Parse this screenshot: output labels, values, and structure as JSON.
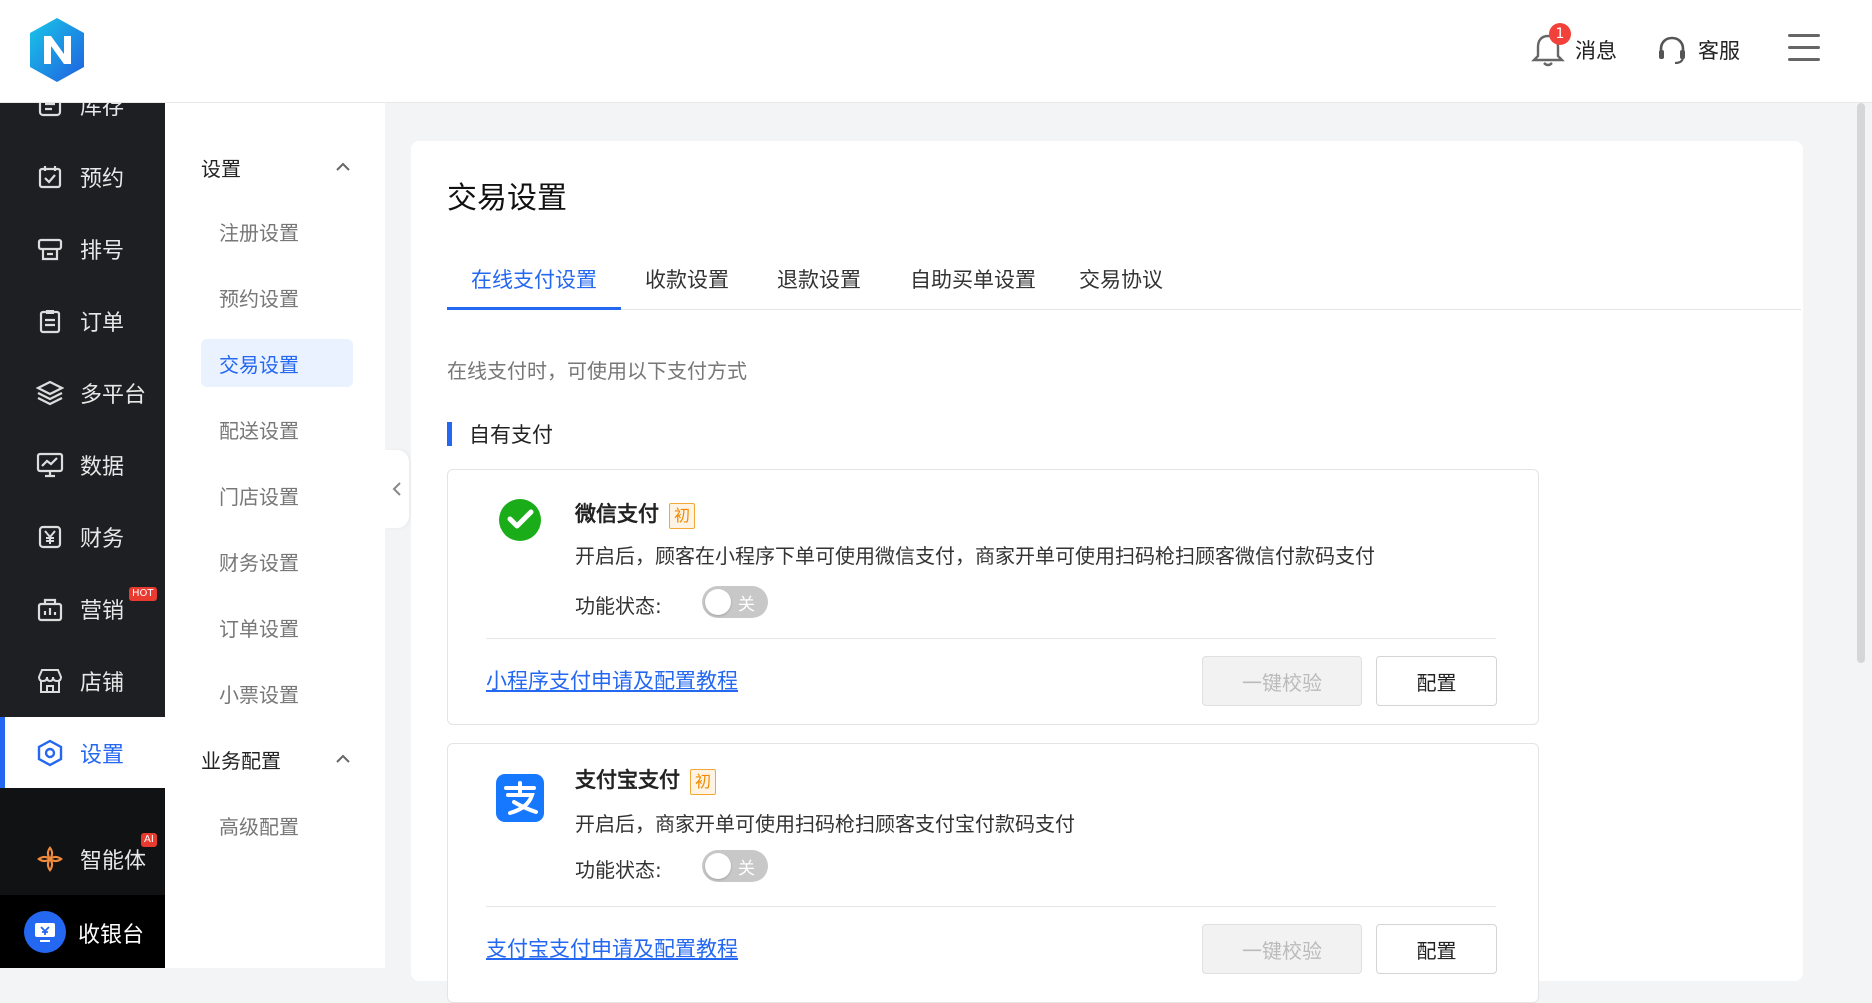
{
  "header": {
    "messages_label": "消息",
    "messages_badge": "1",
    "service_label": "客服"
  },
  "sidebar": {
    "items": [
      {
        "label": "库存",
        "icon": "inventory-icon"
      },
      {
        "label": "预约",
        "icon": "calendar-check-icon"
      },
      {
        "label": "排号",
        "icon": "queue-ticket-icon"
      },
      {
        "label": "订单",
        "icon": "clipboard-icon"
      },
      {
        "label": "多平台",
        "icon": "layers-icon"
      },
      {
        "label": "数据",
        "icon": "chart-monitor-icon"
      },
      {
        "label": "财务",
        "icon": "yen-icon"
      },
      {
        "label": "营销",
        "icon": "marketing-icon",
        "tag": "HOT"
      },
      {
        "label": "店铺",
        "icon": "store-icon"
      },
      {
        "label": "设置",
        "icon": "settings-hex-icon",
        "active": true
      }
    ],
    "agent": {
      "label": "智能体",
      "tag": "AI"
    },
    "cashier": {
      "label": "收银台"
    }
  },
  "subnav": {
    "groups": [
      {
        "label": "设置",
        "items": [
          "注册设置",
          "预约设置",
          "交易设置",
          "配送设置",
          "门店设置",
          "财务设置",
          "订单设置",
          "小票设置"
        ],
        "active": "交易设置"
      },
      {
        "label": "业务配置",
        "items": [
          "高级配置"
        ]
      }
    ]
  },
  "main": {
    "title": "交易设置",
    "tabs": [
      "在线支付设置",
      "收款设置",
      "退款设置",
      "自助买单设置",
      "交易协议"
    ],
    "active_tab": "在线支付设置",
    "description": "在线支付时，可使用以下支付方式",
    "section_title": "自有支付",
    "payments": [
      {
        "name": "微信支付",
        "tag": "初",
        "description": "开启后，顾客在小程序下单可使用微信支付，商家开单可使用扫码枪扫顾客微信付款码支付",
        "status_label": "功能状态:",
        "toggle_text": "关",
        "enabled": false,
        "tutorial_link": "小程序支付申请及配置教程",
        "verify_button": "一键校验",
        "config_button": "配置",
        "icon": "wechat-pay-icon"
      },
      {
        "name": "支付宝支付",
        "tag": "初",
        "description": "开启后，商家开单可使用扫码枪扫顾客支付宝付款码支付",
        "status_label": "功能状态:",
        "toggle_text": "关",
        "enabled": false,
        "tutorial_link": "支付宝支付申请及配置教程",
        "verify_button": "一键校验",
        "config_button": "配置",
        "icon": "alipay-icon"
      }
    ]
  },
  "colors": {
    "accent": "#2468f2",
    "sidebar_bg": "#1e1f22",
    "wechat_green": "#1aad19",
    "alipay_blue": "#1677ff",
    "tag_orange": "#f08a00",
    "badge_red": "#f2413a"
  }
}
